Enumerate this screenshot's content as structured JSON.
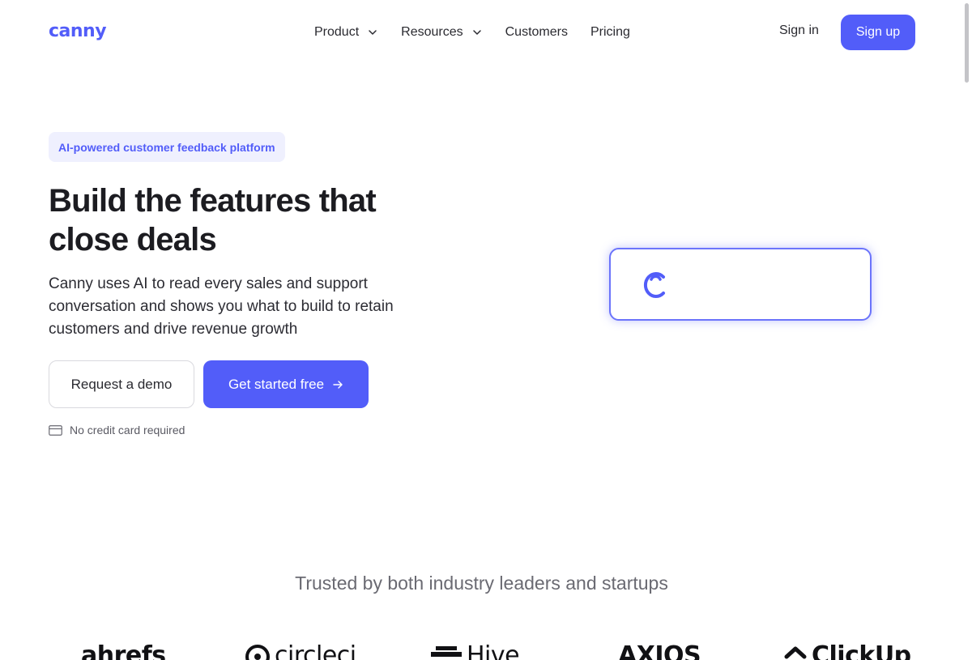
{
  "header": {
    "logo_text": "canny",
    "nav": [
      {
        "label": "Product",
        "has_dropdown": true
      },
      {
        "label": "Resources",
        "has_dropdown": true
      },
      {
        "label": "Customers",
        "has_dropdown": false
      },
      {
        "label": "Pricing",
        "has_dropdown": false
      }
    ],
    "signin_label": "Sign in",
    "signup_label": "Sign up"
  },
  "hero": {
    "badge": "AI-powered customer feedback platform",
    "headline": "Build the features that close deals",
    "subtext": "Canny uses AI to read every sales and support conversation and shows you what to build to retain customers and drive revenue growth",
    "demo_button": "Request a demo",
    "start_button": "Get started free",
    "no_card_note": "No credit card required"
  },
  "trusted": {
    "title": "Trusted by both industry leaders and startups",
    "logos": [
      "ahrefs",
      "circleci",
      "Hive",
      "AXIOS",
      "ClickUp"
    ]
  },
  "colors": {
    "accent": "#525df9",
    "badge_bg": "#eff0fe",
    "text_dark": "#1c1c21",
    "text_muted": "#6a6a72"
  },
  "icons": [
    "chevron-down-icon",
    "arrow-right-icon",
    "credit-card-icon",
    "canny-c-icon"
  ]
}
